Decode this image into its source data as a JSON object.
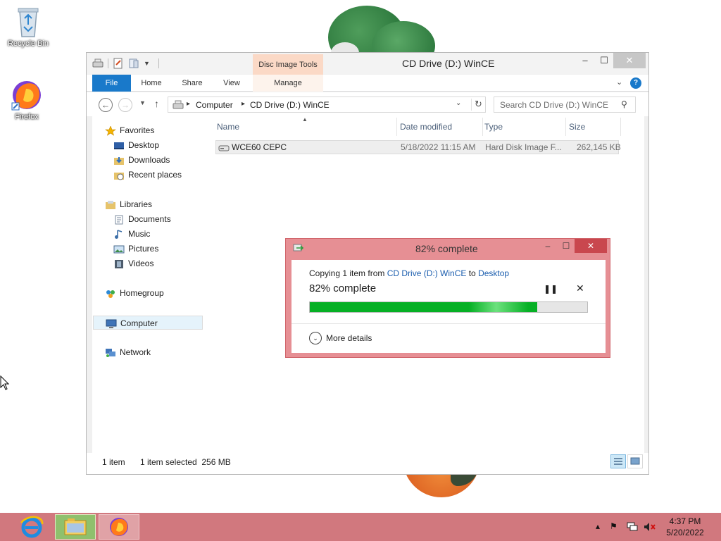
{
  "desktop": {
    "icons": [
      {
        "label": "Recycle Bin"
      },
      {
        "label": "Firefox"
      }
    ]
  },
  "explorer": {
    "title": "CD Drive (D:) WinCE",
    "contextual_tab_group": "Disc Image Tools",
    "ribbon_tabs": {
      "file": "File",
      "home": "Home",
      "share": "Share",
      "view": "View",
      "manage": "Manage"
    },
    "address": {
      "segments": [
        "Computer",
        "CD Drive (D:) WinCE"
      ]
    },
    "search": {
      "placeholder": "Search CD Drive (D:) WinCE"
    },
    "nav_tree": {
      "favorites": "Favorites",
      "desktop": "Desktop",
      "downloads": "Downloads",
      "recent": "Recent places",
      "libraries": "Libraries",
      "documents": "Documents",
      "music": "Music",
      "pictures": "Pictures",
      "videos": "Videos",
      "homegroup": "Homegroup",
      "computer": "Computer",
      "network": "Network"
    },
    "columns": {
      "name": "Name",
      "date": "Date modified",
      "type": "Type",
      "size": "Size"
    },
    "files": [
      {
        "name": "WCE60 CEPC",
        "date": "5/18/2022 11:15 AM",
        "type": "Hard Disk Image F...",
        "size": "262,145 KB"
      }
    ],
    "status": {
      "count": "1 item",
      "selected": "1 item selected  256 MB"
    }
  },
  "copy_dialog": {
    "title": "82% complete",
    "line_prefix": "Copying 1 item from ",
    "source": "CD Drive (D:) WinCE",
    "to": " to ",
    "destination": "Desktop",
    "percent_text": "82% complete",
    "progress": 0.82,
    "more_details": "More details"
  },
  "taskbar": {
    "clock_time": "4:37 PM",
    "clock_date": "5/20/2022"
  }
}
